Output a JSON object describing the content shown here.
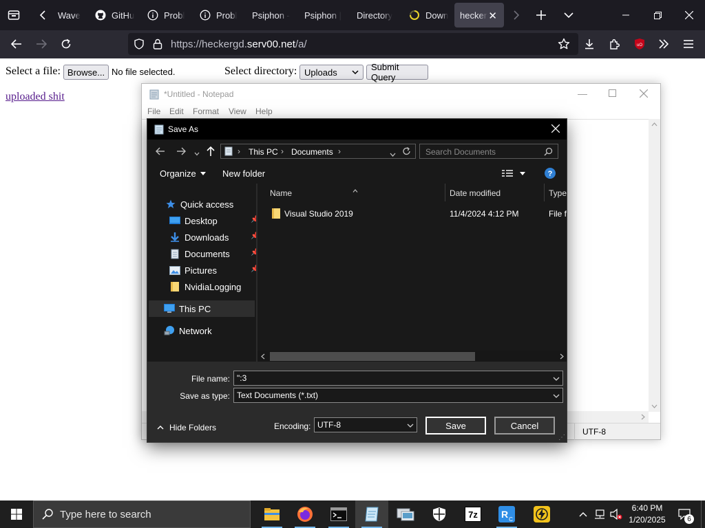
{
  "browser": {
    "tabs": [
      {
        "label": "Wave",
        "icon": "page-icon"
      },
      {
        "label": "GitHu",
        "icon": "github-icon"
      },
      {
        "label": "Probl",
        "icon": "info-icon"
      },
      {
        "label": "Probl",
        "icon": "info-icon"
      },
      {
        "label": "Psiphon -",
        "icon": "none"
      },
      {
        "label": "Psiphon |",
        "icon": "none"
      },
      {
        "label": "Directory",
        "icon": "none"
      },
      {
        "label": "Down",
        "icon": "loading-icon"
      },
      {
        "label": "hecker",
        "icon": "none",
        "active": true
      }
    ],
    "url_prefix": "https://heckergd.",
    "url_domain": "serv00.net",
    "url_suffix": "/a/"
  },
  "page": {
    "select_file_label": "Select a file:",
    "browse_label": "Browse...",
    "no_file_text": "No file selected.",
    "select_dir_label": "Select directory:",
    "directory_value": "Uploads",
    "submit_label": "Submit Query",
    "uploaded_link": "uploaded shit"
  },
  "notepad": {
    "title": "*Untitled - Notepad",
    "menu": [
      "File",
      "Edit",
      "Format",
      "View",
      "Help"
    ],
    "status_encoding": "UTF-8"
  },
  "save_dialog": {
    "title": "Save As",
    "breadcrumb": [
      "This PC",
      "Documents"
    ],
    "search_placeholder": "Search Documents",
    "organize_label": "Organize",
    "new_folder_label": "New folder",
    "nav": {
      "quick_access": "Quick access",
      "desktop": "Desktop",
      "downloads": "Downloads",
      "documents": "Documents",
      "pictures": "Pictures",
      "nvidia": "NvidiaLogging",
      "this_pc": "This PC",
      "network": "Network"
    },
    "columns": {
      "name": "Name",
      "date": "Date modified",
      "type": "Type"
    },
    "files": [
      {
        "name": "Visual Studio 2019",
        "date": "11/4/2024 4:12 PM",
        "type": "File fo"
      }
    ],
    "file_name_label": "File name:",
    "file_name_value": "\":3",
    "save_type_label": "Save as type:",
    "save_type_value": "Text Documents (*.txt)",
    "hide_folders_label": "Hide Folders",
    "encoding_label": "Encoding:",
    "encoding_value": "UTF-8",
    "save_label": "Save",
    "cancel_label": "Cancel"
  },
  "taskbar": {
    "search_placeholder": "Type here to search",
    "time": "6:40 PM",
    "date": "1/20/2025",
    "notification_count": "6"
  },
  "colors": {
    "accent": "#76b9ed",
    "link_visited": "#551a8b",
    "dialog_bg": "#191919"
  }
}
